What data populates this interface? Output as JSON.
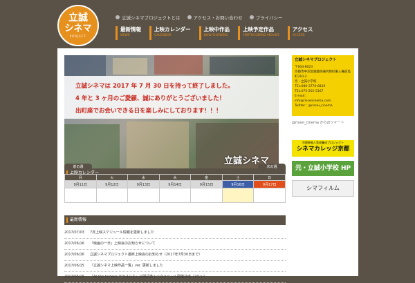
{
  "logo": {
    "line1": "立誠",
    "line2": "シネマ",
    "tag": "PROJECT"
  },
  "toplinks": [
    "立誠シネマプロジェクトとは",
    "アクセス・お問い合わせ",
    "プライバシー"
  ],
  "nav": [
    {
      "ja": "最新情報",
      "en": "NEWS"
    },
    {
      "ja": "上映カレンダー",
      "en": "CALENDAR"
    },
    {
      "ja": "上映中作品",
      "en": "NOW SHOWING"
    },
    {
      "ja": "上映予定作品",
      "en": "FORTHCOMING MOVIES"
    },
    {
      "ja": "アクセス",
      "en": "ACCESS"
    }
  ],
  "hero": {
    "line1": "立誠シネマは 2017 年 7 月 30 日を持って終了しました。",
    "line2": "4 年と 3 ヶ月のご愛顧、誠にありがとうございました！",
    "line3": "出町座でお会いできる日を楽しみにしております！！！",
    "brand": "立誠シネマ"
  },
  "info": {
    "title": "立誠シネマプロジェクト",
    "lines": [
      "〒604-8023",
      "京都市中京区蛸薬師通河原町東入備前島町310-2",
      "元・立誠小学校",
      "TEL:080-3770-6819",
      "TEL:075-201-5167",
      "E-mail：",
      "info@risseicinema.com",
      "Twitter：@rissei_cinema"
    ]
  },
  "twitter": "@rissei_cinema からのツイート",
  "banners": {
    "b1_small": "京都映画人育成養成プロジェクト",
    "b1_big": "シネマカレッジ京都",
    "b2": "元・立誠小学校 HP",
    "b3": "シマフィルム"
  },
  "calendar": {
    "heading": "上映カレンダー",
    "prev": "前の週",
    "next": "次の週",
    "days": [
      "月",
      "火",
      "水",
      "木",
      "金",
      "土",
      "日"
    ],
    "dates": [
      "9月11日",
      "9月12日",
      "9月13日",
      "9月14日",
      "9月15日",
      "9月16日",
      "9月17日"
    ]
  },
  "news": {
    "heading": "最新情報",
    "items": [
      {
        "date": "2017/07/03",
        "title": "7月上映スケジュール情報を更新しました"
      },
      {
        "date": "2017/06/16",
        "title": "『映画の一日』上映会のお知らせについて"
      },
      {
        "date": "2017/06/16",
        "title": "立誠シネマプロジェクト最終上映会のお知らせ（2017年7月30日まで）"
      },
      {
        "date": "2017/06/15",
        "title": "『立誠シネマ上映作品一覧』ver. 更新しました"
      },
      {
        "date": "2017/06/15",
        "title": "『At the terrace テラスにて』公開記念トークイベント開催決定（7/1〜）"
      }
    ]
  }
}
